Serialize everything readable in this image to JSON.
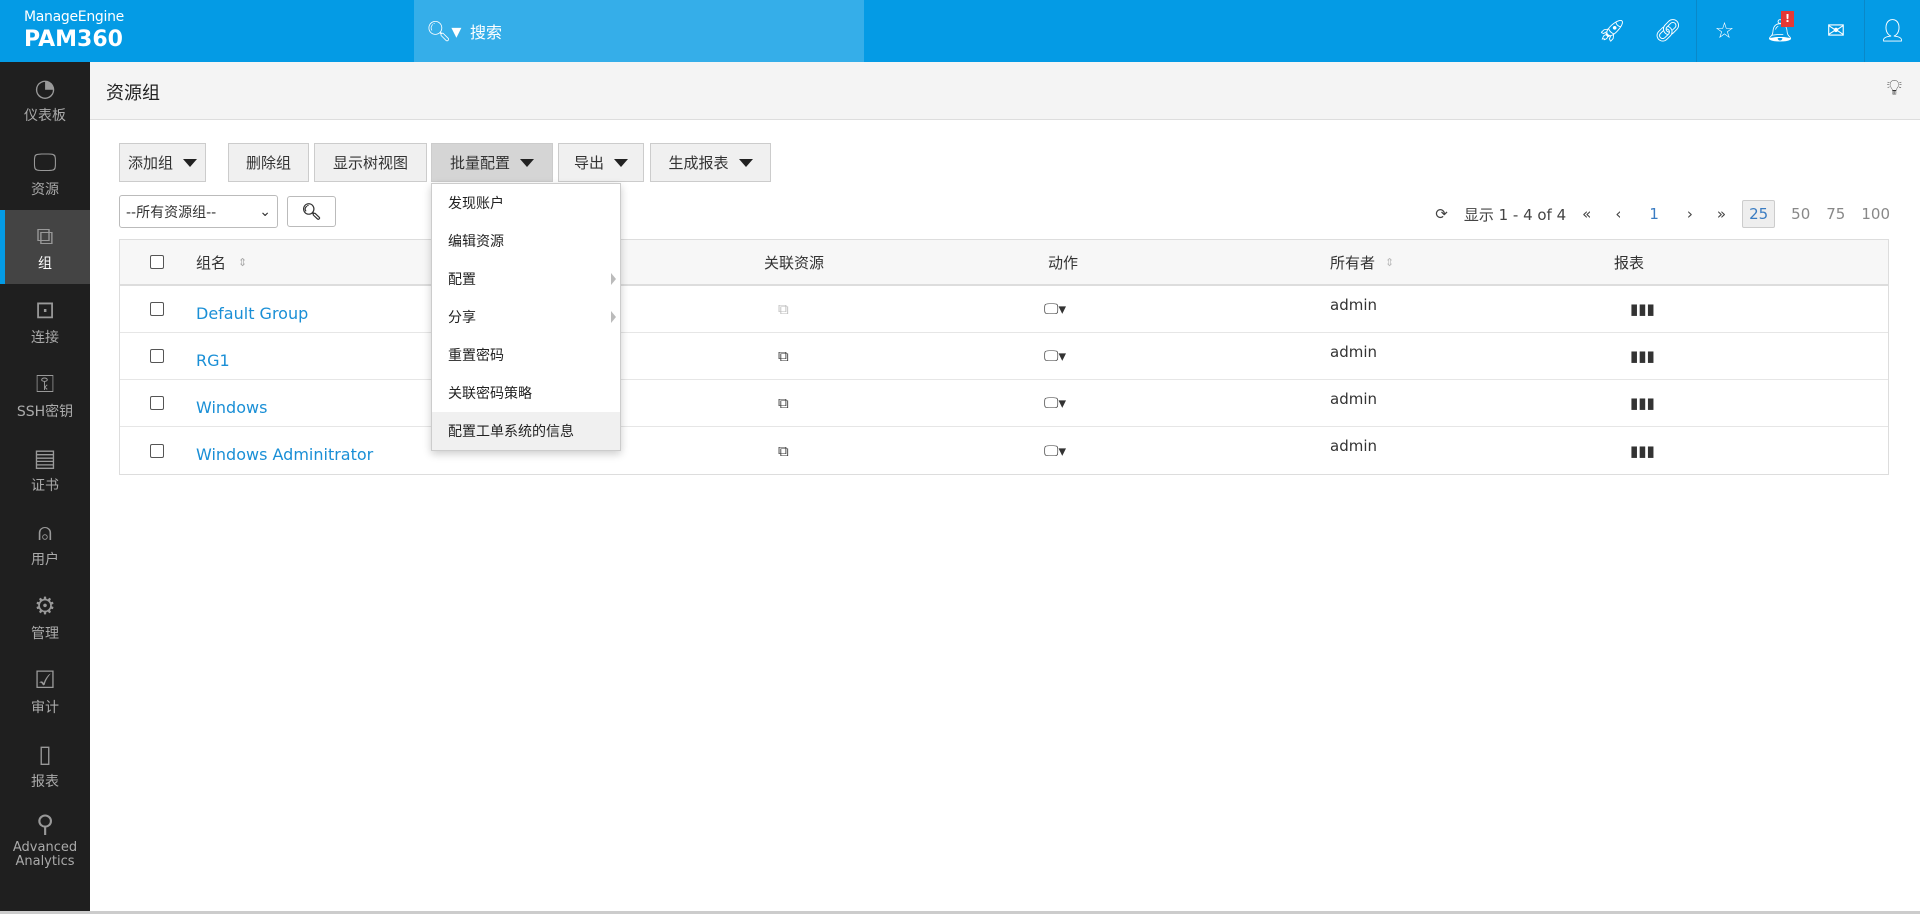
{
  "header": {
    "brand": "ManageEngine",
    "product": "PAM360",
    "search_placeholder": "搜索",
    "icons": [
      "rocket-icon",
      "link-icon",
      "user-star-icon",
      "bell-icon",
      "mail-icon",
      "user-icon"
    ],
    "alert_badge": "!"
  },
  "sidebar": {
    "items": [
      {
        "label": "仪表板",
        "icon": "◔"
      },
      {
        "label": "资源",
        "icon": "🖵"
      },
      {
        "label": "组",
        "icon": "⧉",
        "active": true
      },
      {
        "label": "连接",
        "icon": "⊡"
      },
      {
        "label": "SSH密钥",
        "icon": "⚿"
      },
      {
        "label": "证书",
        "icon": "▤"
      },
      {
        "label": "用户",
        "icon": "⍝"
      },
      {
        "label": "管理",
        "icon": "⚙"
      },
      {
        "label": "审计",
        "icon": "☑"
      },
      {
        "label": "报表",
        "icon": "▯"
      },
      {
        "label": "Advanced Analytics",
        "icon": "⚲"
      }
    ]
  },
  "page": {
    "title": "资源组"
  },
  "toolbar": {
    "add_group": "添加组",
    "delete_group": "删除组",
    "tree_view": "显示树视图",
    "bulk_config": "批量配置",
    "export": "导出",
    "report": "生成报表"
  },
  "filter": {
    "selected": "--所有资源组--"
  },
  "pagination": {
    "display": "显示 1 - 4 of 4",
    "page": "1",
    "sizes": [
      "25",
      "50",
      "75",
      "100"
    ],
    "selected_size": "25"
  },
  "table": {
    "headers": {
      "name": "组名",
      "resources": "关联资源",
      "actions": "动作",
      "owner": "所有者",
      "reports": "报表"
    },
    "rows": [
      {
        "name": "Default Group",
        "owner": "admin",
        "disabled": true
      },
      {
        "name": "RG1",
        "owner": "admin"
      },
      {
        "name": "Windows",
        "owner": "admin"
      },
      {
        "name": "Windows Adminitrator",
        "owner": "admin"
      }
    ]
  },
  "bulk_menu": {
    "items": [
      "发现账户",
      "编辑资源",
      "配置",
      "分享",
      "重置密码",
      "关联密码策略",
      "配置工单系统的信息"
    ]
  },
  "colors": {
    "brand": "#049be5",
    "sidebar": "#1f1f1f",
    "link": "#1a8fd6"
  }
}
